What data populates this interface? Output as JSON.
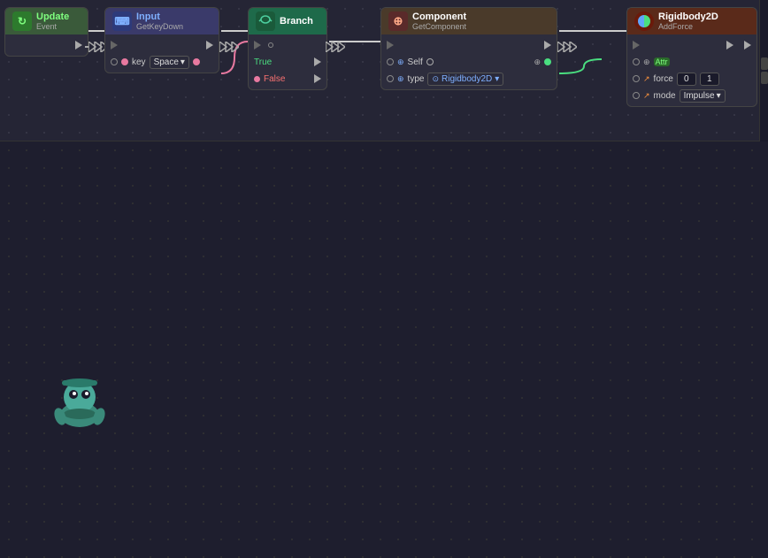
{
  "canvas": {
    "background_color": "#252535"
  },
  "nodes": {
    "update_event": {
      "title": "Update",
      "subtitle": "Event",
      "icon": "↻",
      "icon_color": "icon-green"
    },
    "get_key_down": {
      "title": "Input",
      "subtitle": "GetKeyDown",
      "icon": "⌨",
      "icon_color": "icon-blue",
      "params": {
        "key_label": "key",
        "key_value": "Space"
      }
    },
    "branch": {
      "title": "Branch",
      "icon": "⟳",
      "icon_color": "icon-teal",
      "outputs": {
        "true_label": "True",
        "false_label": "False"
      }
    },
    "get_component": {
      "title": "Component",
      "subtitle": "GetComponent",
      "icon": "⊕",
      "icon_color": "icon-purple",
      "params": {
        "self_label": "Self",
        "type_label": "type",
        "type_value": "Rigidbody2D"
      }
    },
    "add_force": {
      "title": "Rigidbody2D",
      "subtitle": "AddForce",
      "icon": "●",
      "icon_color": "icon-orange",
      "params": {
        "force_label": "force",
        "force_x": "0",
        "force_y": "1",
        "mode_label": "mode",
        "mode_value": "Impulse"
      }
    }
  },
  "mascot": {
    "color": "#4a9a8a"
  },
  "connections": [
    {
      "from": "update_event",
      "to": "get_key_down",
      "type": "exec"
    },
    {
      "from": "get_key_down",
      "to": "branch",
      "type": "exec"
    },
    {
      "from": "branch_true",
      "to": "get_component",
      "type": "exec"
    },
    {
      "from": "get_component",
      "to": "add_force",
      "type": "exec"
    }
  ]
}
